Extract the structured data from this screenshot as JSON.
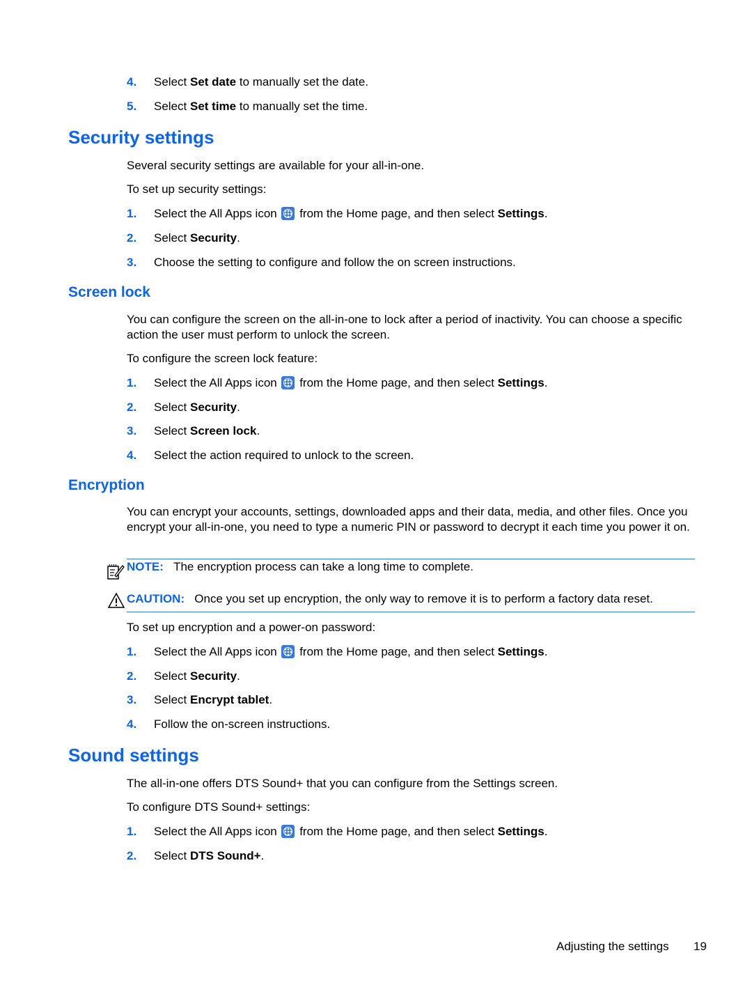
{
  "top_steps": [
    {
      "num": "4.",
      "pre": "Select ",
      "bold": "Set date",
      "post": " to manually set the date."
    },
    {
      "num": "5.",
      "pre": "Select ",
      "bold": "Set time",
      "post": " to manually set the time."
    }
  ],
  "security": {
    "title": "Security settings",
    "intro": "Several security settings are available for your all-in-one.",
    "lead": "To set up security settings:",
    "steps": [
      {
        "num": "1.",
        "pre": "Select the All Apps icon",
        "post": " from the Home page, and then select ",
        "bold": "Settings",
        "end": "."
      },
      {
        "num": "2.",
        "pre": "Select ",
        "bold": "Security",
        "end": "."
      },
      {
        "num": "3.",
        "text": "Choose the setting to configure and follow the on screen instructions."
      }
    ]
  },
  "screen_lock": {
    "title": "Screen lock",
    "intro": "You can configure the screen on the all-in-one to lock after a period of inactivity. You can choose a specific action the user must perform to unlock the screen.",
    "lead": "To configure the screen lock feature:",
    "steps": [
      {
        "num": "1.",
        "pre": "Select the All Apps icon",
        "post": " from the Home page, and then select ",
        "bold": "Settings",
        "end": "."
      },
      {
        "num": "2.",
        "pre": "Select ",
        "bold": "Security",
        "end": "."
      },
      {
        "num": "3.",
        "pre": "Select ",
        "bold": "Screen lock",
        "end": "."
      },
      {
        "num": "4.",
        "text": "Select the action required to unlock to the screen."
      }
    ]
  },
  "encryption": {
    "title": "Encryption",
    "intro": "You can encrypt your accounts, settings, downloaded apps and their data, media, and other files. Once you encrypt your all-in-one, you need to type a numeric PIN or password to decrypt it each time you power it on.",
    "note_label": "NOTE:",
    "note_text": "The encryption process can take a long time to complete.",
    "caution_label": "CAUTION:",
    "caution_text": "Once you set up encryption, the only way to remove it is to perform a factory data reset.",
    "lead": "To set up encryption and a power-on password:",
    "steps": [
      {
        "num": "1.",
        "pre": "Select the All Apps icon",
        "post": " from the Home page, and then select ",
        "bold": "Settings",
        "end": "."
      },
      {
        "num": "2.",
        "pre": "Select ",
        "bold": "Security",
        "end": "."
      },
      {
        "num": "3.",
        "pre": "Select ",
        "bold": "Encrypt tablet",
        "end": "."
      },
      {
        "num": "4.",
        "text": "Follow the on-screen instructions."
      }
    ]
  },
  "sound": {
    "title": "Sound settings",
    "intro": "The all-in-one offers DTS Sound+ that you can configure from the Settings screen.",
    "lead": "To configure DTS Sound+ settings:",
    "steps": [
      {
        "num": "1.",
        "pre": "Select the All Apps icon",
        "post": " from the Home page, and then select ",
        "bold": "Settings",
        "end": "."
      },
      {
        "num": "2.",
        "pre": "Select ",
        "bold": "DTS Sound+",
        "end": "."
      }
    ]
  },
  "footer": {
    "section": "Adjusting the settings",
    "page": "19"
  }
}
